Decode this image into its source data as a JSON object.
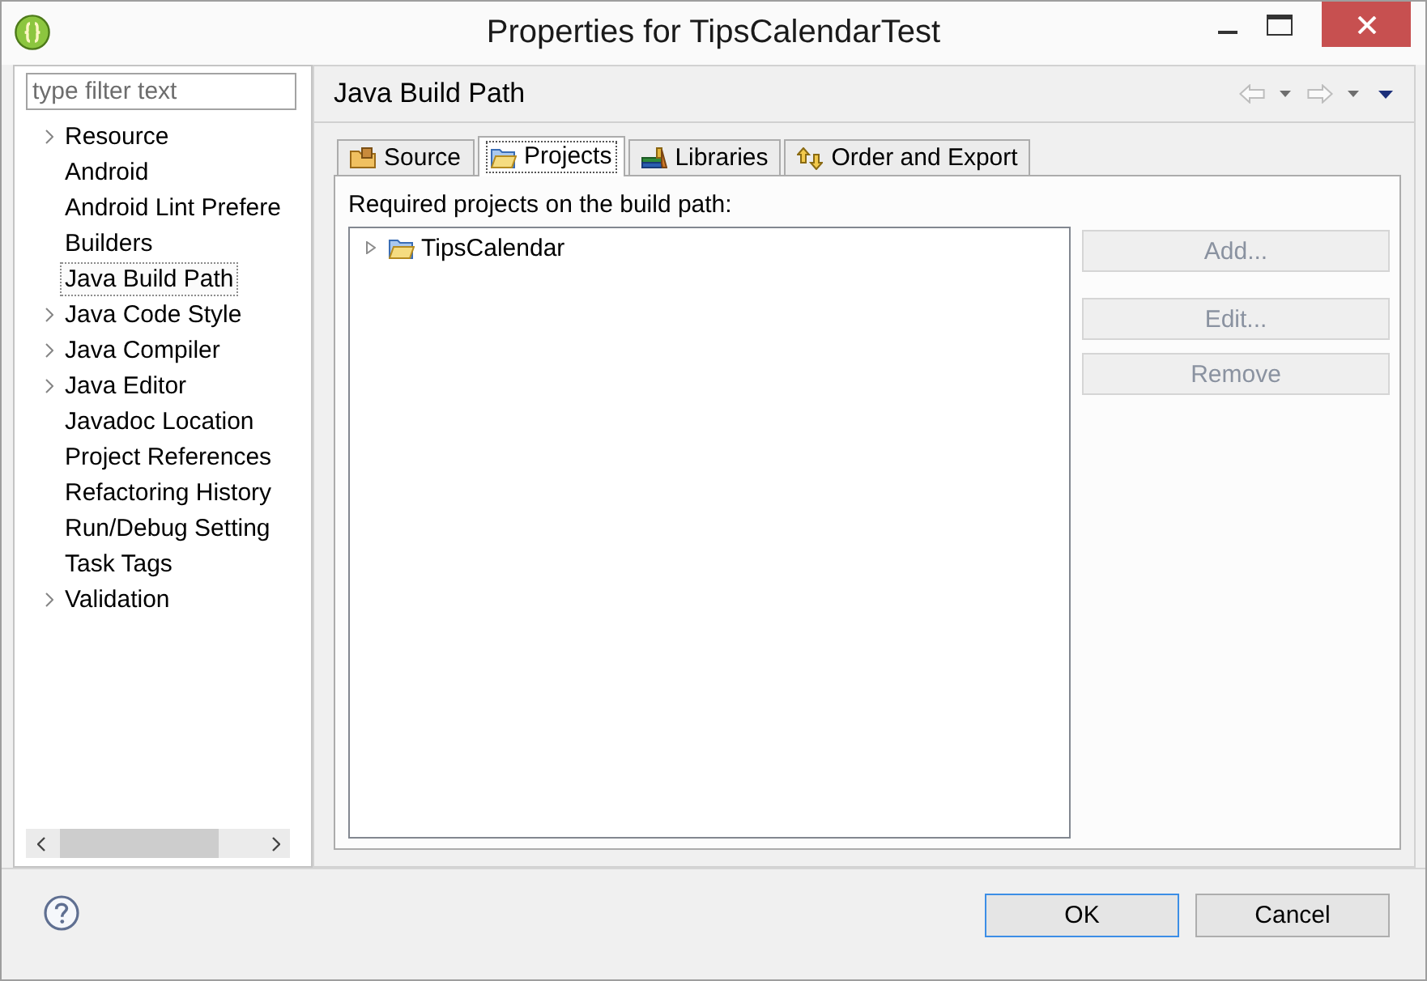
{
  "window": {
    "title": "Properties for TipsCalendarTest"
  },
  "sidebar": {
    "filter": {
      "placeholder": "type filter text"
    },
    "items": [
      {
        "label": "Resource",
        "expandable": true,
        "selected": false
      },
      {
        "label": "Android",
        "expandable": false,
        "selected": false
      },
      {
        "label": "Android Lint Prefere",
        "expandable": false,
        "selected": false
      },
      {
        "label": "Builders",
        "expandable": false,
        "selected": false
      },
      {
        "label": "Java Build Path",
        "expandable": false,
        "selected": true
      },
      {
        "label": "Java Code Style",
        "expandable": true,
        "selected": false
      },
      {
        "label": "Java Compiler",
        "expandable": true,
        "selected": false
      },
      {
        "label": "Java Editor",
        "expandable": true,
        "selected": false
      },
      {
        "label": "Javadoc Location",
        "expandable": false,
        "selected": false
      },
      {
        "label": "Project References",
        "expandable": false,
        "selected": false
      },
      {
        "label": "Refactoring History",
        "expandable": false,
        "selected": false
      },
      {
        "label": "Run/Debug Setting",
        "expandable": false,
        "selected": false
      },
      {
        "label": "Task Tags",
        "expandable": false,
        "selected": false
      },
      {
        "label": "Validation",
        "expandable": true,
        "selected": false
      }
    ]
  },
  "page": {
    "title": "Java Build Path",
    "history": [
      {
        "kind": "back",
        "disabled": true
      },
      {
        "kind": "forward",
        "disabled": true
      }
    ],
    "tabs": [
      {
        "label": "Source",
        "kind": "source",
        "selected": false
      },
      {
        "label": "Projects",
        "kind": "projects",
        "selected": true
      },
      {
        "label": "Libraries",
        "kind": "libraries",
        "selected": false
      },
      {
        "label": "Order and Export",
        "kind": "order",
        "selected": false
      }
    ],
    "list_label": "Required projects on the build path:",
    "projects": [
      {
        "label": "TipsCalendar",
        "expandable": true
      }
    ],
    "buttons": [
      {
        "label": "Add...",
        "disabled": true
      },
      {
        "label": "Edit...",
        "disabled": true
      },
      {
        "label": "Remove",
        "disabled": true
      }
    ]
  },
  "footer": {
    "buttons": [
      {
        "label": "OK",
        "default": true
      },
      {
        "label": "Cancel",
        "default": false
      }
    ]
  }
}
